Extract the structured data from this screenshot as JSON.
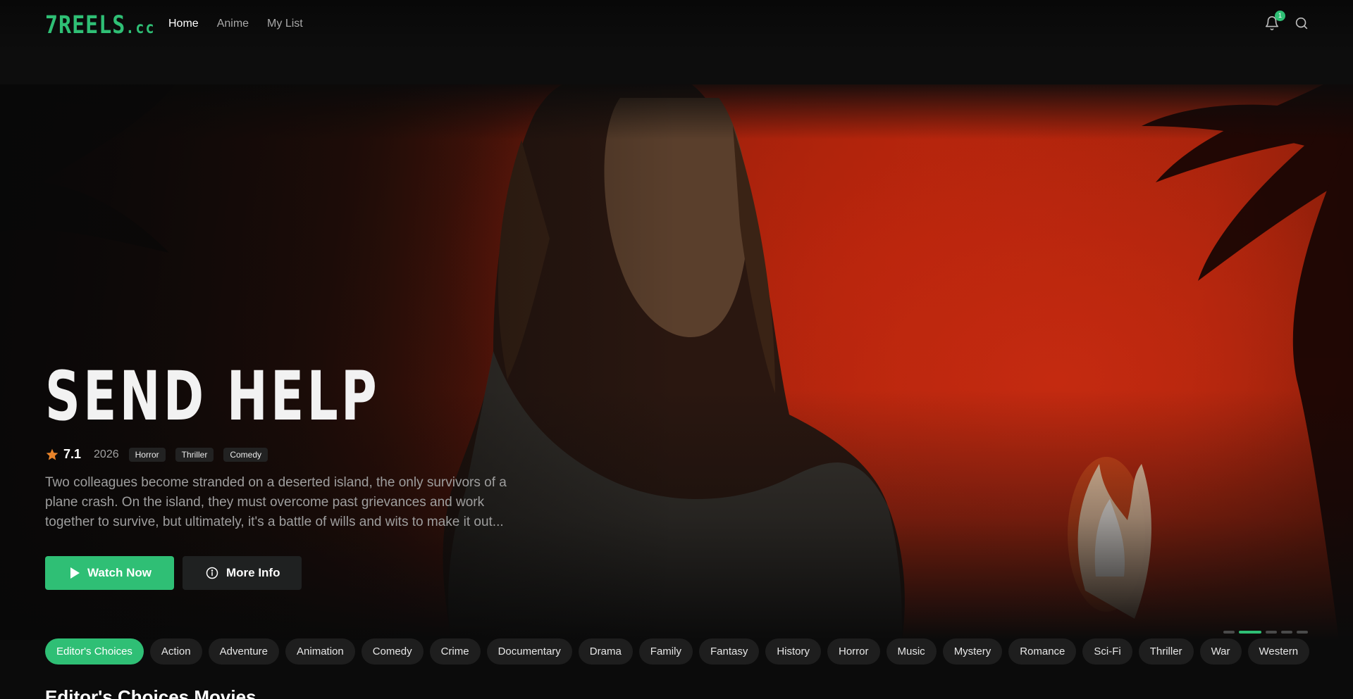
{
  "nav": {
    "logo_main": "7REELS",
    "logo_tld": ".cc",
    "links": [
      "Home",
      "Anime",
      "My List"
    ],
    "notification_count": "1"
  },
  "hero": {
    "title": "SEND HELP",
    "rating": "7.1",
    "year": "2026",
    "tags": [
      "Horror",
      "Thriller",
      "Comedy"
    ],
    "description": "Two colleagues become stranded on a deserted island, the only survivors of a plane crash. On the island, they must overcome past grievances and work together to survive, but ultimately, it's a battle of wills and wits to make it out...",
    "watch_label": "Watch Now",
    "info_label": "More Info"
  },
  "genres": [
    "Editor's Choices",
    "Action",
    "Adventure",
    "Animation",
    "Comedy",
    "Crime",
    "Documentary",
    "Drama",
    "Family",
    "Fantasy",
    "History",
    "Horror",
    "Music",
    "Mystery",
    "Romance",
    "Sci-Fi",
    "Thriller",
    "War",
    "Western"
  ],
  "section": {
    "title": "Editor's Choices Movies"
  },
  "colors": {
    "accent": "#2fbf75",
    "star": "#e8832a"
  }
}
